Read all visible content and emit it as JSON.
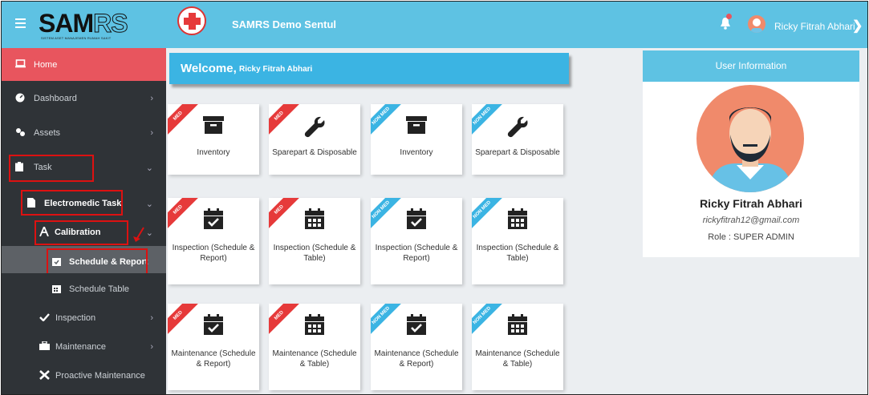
{
  "sidebar": {
    "logo": {
      "text_main": "SAM",
      "text_accent": "RS",
      "tagline": "SISTEM ASET MANAJEMEN RUMAH SAKIT"
    },
    "items": [
      {
        "label": "Home",
        "icon": "laptop-icon"
      },
      {
        "label": "Dashboard",
        "icon": "dashboard-icon"
      },
      {
        "label": "Assets",
        "icon": "assets-icon"
      },
      {
        "label": "Task",
        "icon": "clipboard-icon"
      },
      {
        "label": "Electromedic Task",
        "icon": "file-icon"
      },
      {
        "label": "Calibration",
        "icon": "compass-icon"
      },
      {
        "label": "Schedule & Report",
        "icon": "calendar-check-icon"
      },
      {
        "label": "Schedule Table",
        "icon": "calendar-icon"
      },
      {
        "label": "Inspection",
        "icon": "check-icon"
      },
      {
        "label": "Maintenance",
        "icon": "toolbox-icon"
      },
      {
        "label": "Proactive Maintenance",
        "icon": "tools-icon"
      }
    ]
  },
  "topbar": {
    "title": "SAMRS Demo Sentul",
    "user": "Ricky Fitrah Abhari"
  },
  "welcome": {
    "greeting": "Welcome,",
    "name": "Ricky Fitrah Abhari"
  },
  "cards": [
    {
      "tag": "MED",
      "caption": "Inventory",
      "icon": "archive-icon"
    },
    {
      "tag": "MED",
      "caption": "Sparepart & Disposable",
      "icon": "wrench-icon"
    },
    {
      "tag": "NON MED",
      "caption": "Inventory",
      "icon": "archive-icon"
    },
    {
      "tag": "NON MED",
      "caption": "Sparepart & Disposable",
      "icon": "wrench-icon"
    },
    {
      "tag": "MED",
      "caption": "Inspection (Schedule & Report)",
      "icon": "calendar-check-icon"
    },
    {
      "tag": "MED",
      "caption": "Inspection (Schedule & Table)",
      "icon": "calendar-icon"
    },
    {
      "tag": "NON MED",
      "caption": "Inspection (Schedule & Report)",
      "icon": "calendar-check-icon"
    },
    {
      "tag": "NON MED",
      "caption": "Inspection (Schedule & Table)",
      "icon": "calendar-icon"
    },
    {
      "tag": "MED",
      "caption": "Maintenance (Schedule & Report)",
      "icon": "calendar-check-icon"
    },
    {
      "tag": "MED",
      "caption": "Maintenance (Schedule & Table)",
      "icon": "calendar-icon"
    },
    {
      "tag": "NON MED",
      "caption": "Maintenance (Schedule & Report)",
      "icon": "calendar-check-icon"
    },
    {
      "tag": "NON MED",
      "caption": "Maintenance (Schedule & Table)",
      "icon": "calendar-icon"
    }
  ],
  "user_info": {
    "heading": "User Information",
    "name": "Ricky Fitrah Abhari",
    "email": "rickyfitrah12@gmail.com",
    "role": "Role : SUPER ADMIN"
  },
  "colors": {
    "accent": "#5ec2e3",
    "home": "#e8555e",
    "sidebar": "#2f3337",
    "med": "#e63a3a",
    "nonmed": "#3bb4e3"
  }
}
